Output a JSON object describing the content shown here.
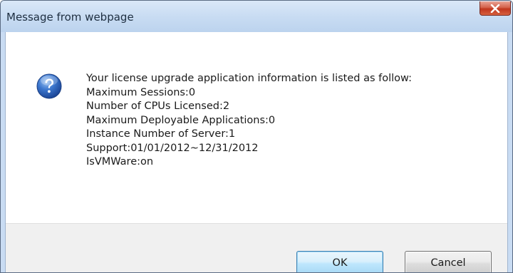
{
  "window": {
    "title": "Message from webpage",
    "close_icon": "close-icon"
  },
  "message": {
    "icon": "question-icon",
    "lines": [
      "Your license upgrade application information is listed as follow:",
      "Maximum Sessions:0",
      "Number of CPUs Licensed:2",
      "Maximum Deployable Applications:0",
      "Instance Number of Server:1",
      "Support:01/01/2012~12/31/2012",
      "IsVMWare:on"
    ]
  },
  "buttons": {
    "ok_label": "OK",
    "cancel_label": "Cancel"
  },
  "colors": {
    "titlebar": "#c7dbf2",
    "close_button": "#c1361e",
    "question_icon": "#2a5fb5",
    "ok_border": "#3c7fb1"
  }
}
